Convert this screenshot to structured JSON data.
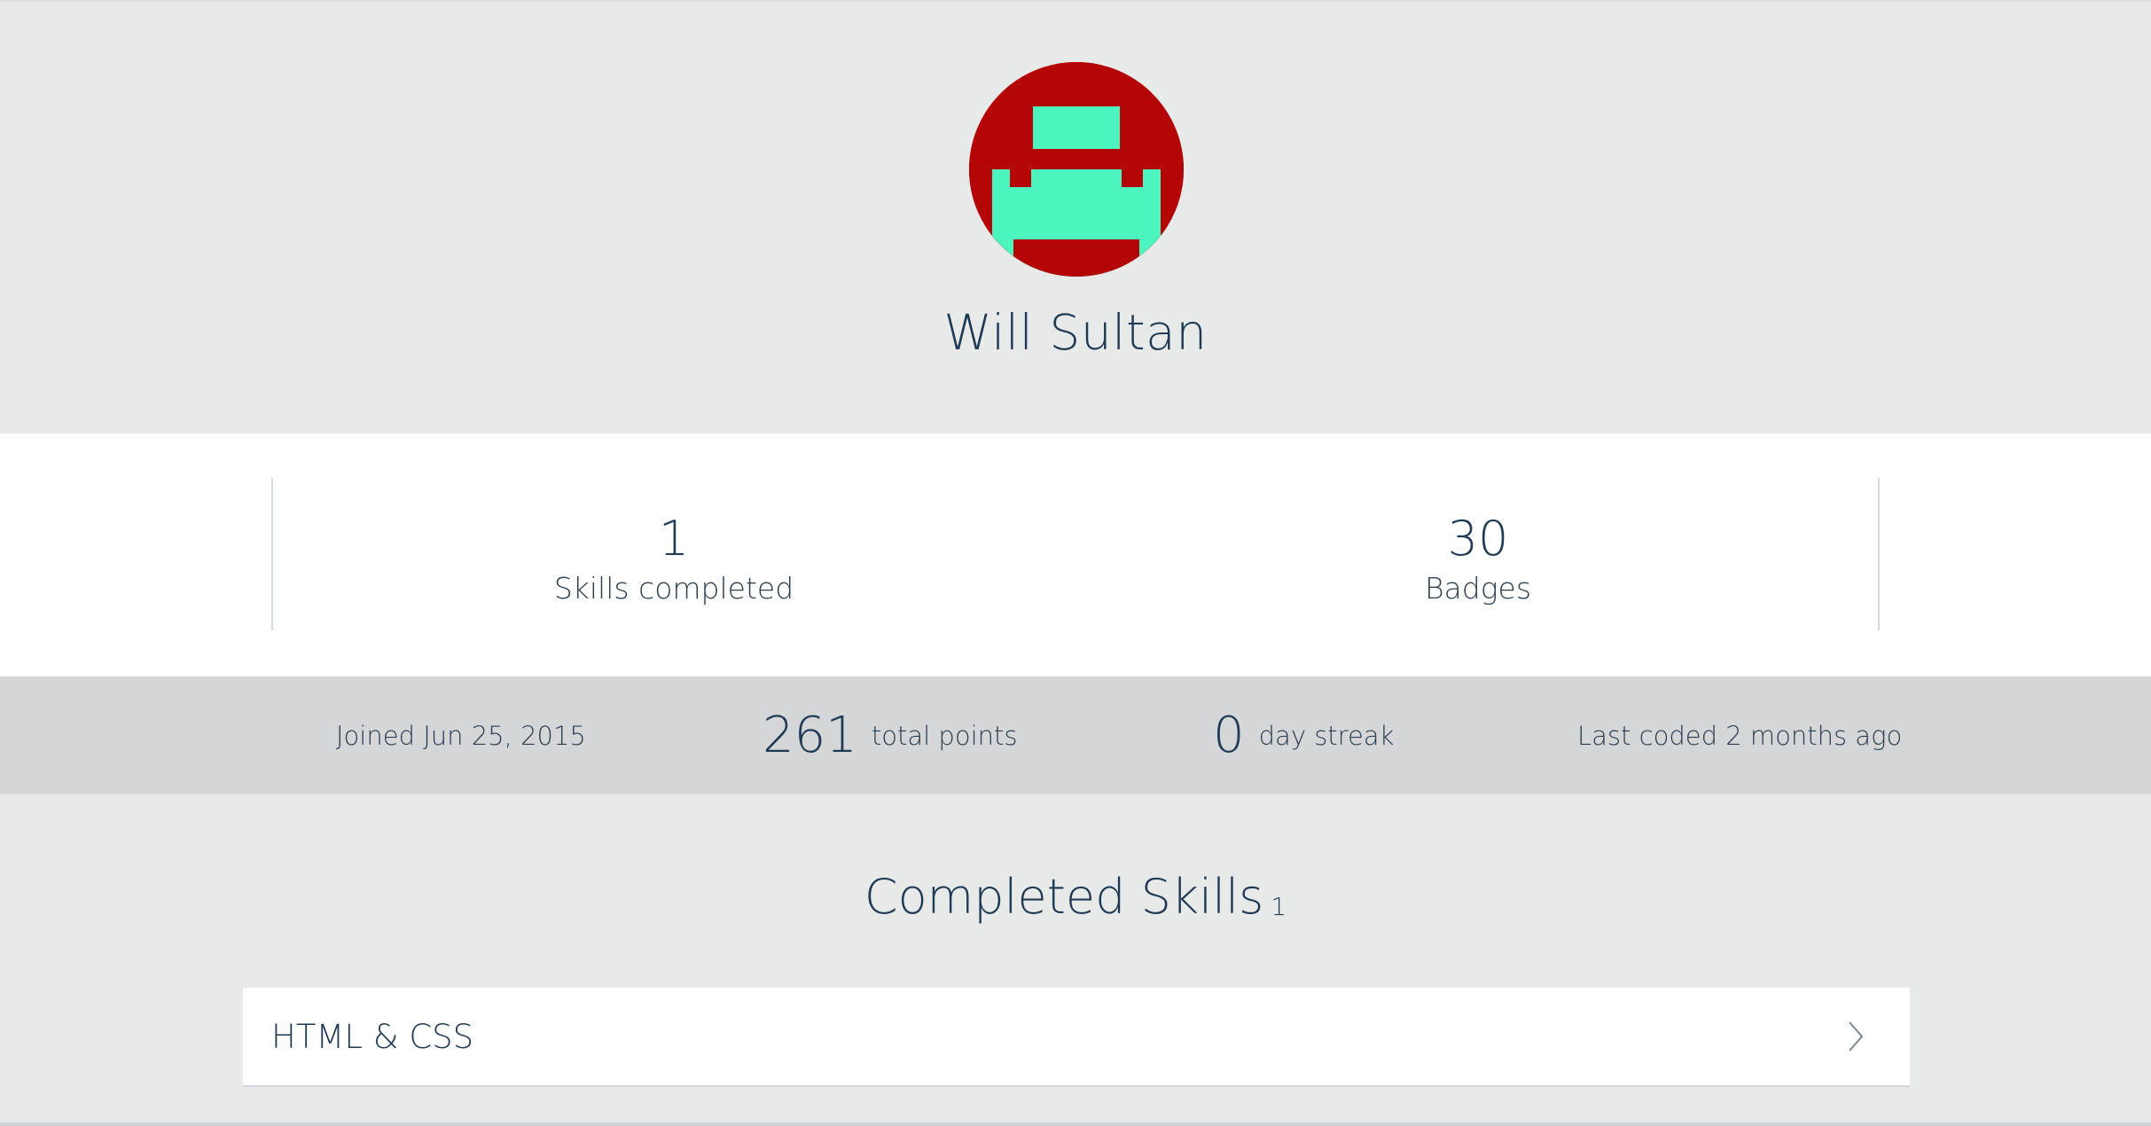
{
  "profile": {
    "name": "Will Sultan",
    "avatar_icon": "pixel-robot-icon",
    "avatar_colors": {
      "background": "#b40606",
      "foreground": "#4cf5bd"
    }
  },
  "stats": {
    "skills_completed": {
      "value": "1",
      "label": "Skills completed"
    },
    "badges": {
      "value": "30",
      "label": "Badges"
    }
  },
  "meta": {
    "joined": "Joined Jun 25, 2015",
    "points_value": "261",
    "points_label": "total points",
    "streak_value": "0",
    "streak_label": "day streak",
    "last_coded": "Last coded 2 months ago"
  },
  "completed_skills": {
    "title": "Completed Skills",
    "count": "1",
    "items": [
      {
        "name": "HTML & CSS",
        "icon": "chevron-right-icon"
      }
    ]
  }
}
